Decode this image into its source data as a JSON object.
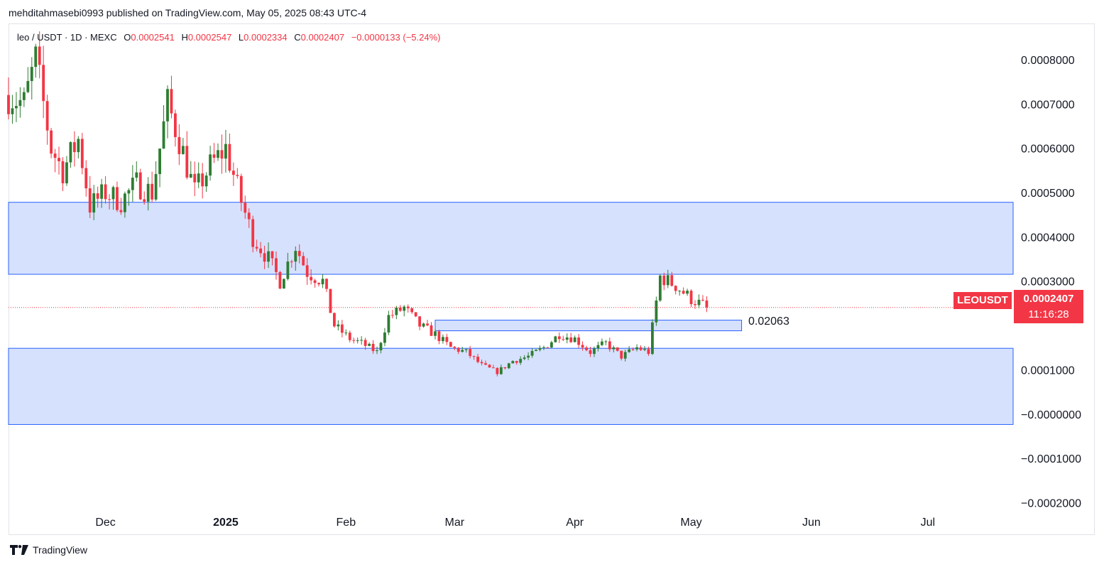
{
  "header": {
    "publisher_line": "mehditahmasebi0993 published on TradingView.com, May 05, 2025 08:43 UTC-4"
  },
  "legend": {
    "symbol": "leo / USDT · 1D · MEXC",
    "o_label": "O",
    "o_value": "0.0002541",
    "h_label": "H",
    "h_value": "0.0002547",
    "l_label": "L",
    "l_value": "0.0002334",
    "c_label": "C",
    "c_value": "0.0002407",
    "change": "−0.0000133 (−5.24%)"
  },
  "price_tag": {
    "symbol": "LEOUSDT",
    "price": "0.0002407",
    "countdown": "11:16:28"
  },
  "zone_label": "0.02063",
  "footer": {
    "brand": "TradingView",
    "logo_icon": "tradingview-logo-icon"
  },
  "colors": {
    "up": "#22ab94",
    "up_body": "#2e7d32",
    "down": "#f23645",
    "zone_fill": "#d6e1fd",
    "zone_line": "#2962ff"
  },
  "chart_data": {
    "type": "candlestick",
    "title": "",
    "xlabel": "",
    "ylabel": "",
    "ylim": [
      -0.00022,
      0.00088
    ],
    "y_ticks": [
      "0.0008000",
      "0.0007000",
      "0.0006000",
      "0.0005000",
      "0.0004000",
      "0.0003000",
      "0.0001000",
      "−0.0000000",
      "−0.0001000",
      "−0.0002000"
    ],
    "y_tick_values": [
      0.0008,
      0.0007,
      0.0006,
      0.0005,
      0.0004,
      0.0003,
      0.0001,
      0.0,
      -0.0001,
      -0.0002
    ],
    "x_ticks": [
      "Dec",
      "2025",
      "Feb",
      "Mar",
      "Apr",
      "May",
      "Jun",
      "Jul"
    ],
    "x_tick_dates": [
      "2024-12-01",
      "2025-01-01",
      "2025-02-01",
      "2025-03-01",
      "2025-04-01",
      "2025-05-01",
      "2025-06-01",
      "2025-07-01"
    ],
    "x_range": [
      "2024-11-06",
      "2025-07-23"
    ],
    "zones": [
      {
        "name": "",
        "from": 0.0003155,
        "to": 0.000478,
        "start": "2024-11-06",
        "end": "2025-07-23"
      },
      {
        "name": "",
        "from": -2.35e-05,
        "to": 0.0001485,
        "start": "2024-11-06",
        "end": "2025-07-23"
      },
      {
        "name": "",
        "from": 0.000188,
        "to": 0.000212,
        "start": "2025-02-24",
        "end": "2025-05-14"
      }
    ],
    "last_price": 0.0002407,
    "anchors": [
      [
        "2024-11-06",
        0.00072
      ],
      [
        "2024-11-10",
        0.0007
      ],
      [
        "2024-11-13",
        0.0008
      ],
      [
        "2024-11-17",
        0.0006
      ],
      [
        "2024-11-20",
        0.00055
      ],
      [
        "2024-11-24",
        0.00062
      ],
      [
        "2024-11-27",
        0.00047
      ],
      [
        "2024-12-01",
        0.0005
      ],
      [
        "2024-12-05",
        0.00048
      ],
      [
        "2024-12-09",
        0.00052
      ],
      [
        "2024-12-13",
        0.0005
      ],
      [
        "2024-12-17",
        0.0007
      ],
      [
        "2024-12-20",
        0.00062
      ],
      [
        "2024-12-24",
        0.0005
      ],
      [
        "2024-12-28",
        0.00056
      ],
      [
        "2025-01-01",
        0.0006
      ],
      [
        "2025-01-05",
        0.00048
      ],
      [
        "2025-01-08",
        0.0004
      ],
      [
        "2025-01-12",
        0.00035
      ],
      [
        "2025-01-15",
        0.0003
      ],
      [
        "2025-01-19",
        0.00038
      ],
      [
        "2025-01-22",
        0.00032
      ],
      [
        "2025-01-26",
        0.0003
      ],
      [
        "2025-01-29",
        0.0002
      ],
      [
        "2025-02-02",
        0.00017
      ],
      [
        "2025-02-05",
        0.00016
      ],
      [
        "2025-02-09",
        0.00014
      ],
      [
        "2025-02-12",
        0.00022
      ],
      [
        "2025-02-16",
        0.00024
      ],
      [
        "2025-02-20",
        0.0002
      ],
      [
        "2025-02-24",
        0.00018
      ],
      [
        "2025-02-28",
        0.00015
      ],
      [
        "2025-03-04",
        0.00014
      ],
      [
        "2025-03-08",
        0.00011
      ],
      [
        "2025-03-12",
        9.5e-05
      ],
      [
        "2025-03-16",
        0.00012
      ],
      [
        "2025-03-20",
        0.00013
      ],
      [
        "2025-03-24",
        0.00015
      ],
      [
        "2025-03-28",
        0.00018
      ],
      [
        "2025-04-01",
        0.00017
      ],
      [
        "2025-04-05",
        0.00014
      ],
      [
        "2025-04-09",
        0.00016
      ],
      [
        "2025-04-13",
        0.00013
      ],
      [
        "2025-04-17",
        0.00015
      ],
      [
        "2025-04-20",
        0.00014
      ],
      [
        "2025-04-23",
        0.00031
      ],
      [
        "2025-04-27",
        0.00029
      ],
      [
        "2025-05-01",
        0.00026
      ],
      [
        "2025-05-05",
        0.0002407
      ]
    ]
  }
}
